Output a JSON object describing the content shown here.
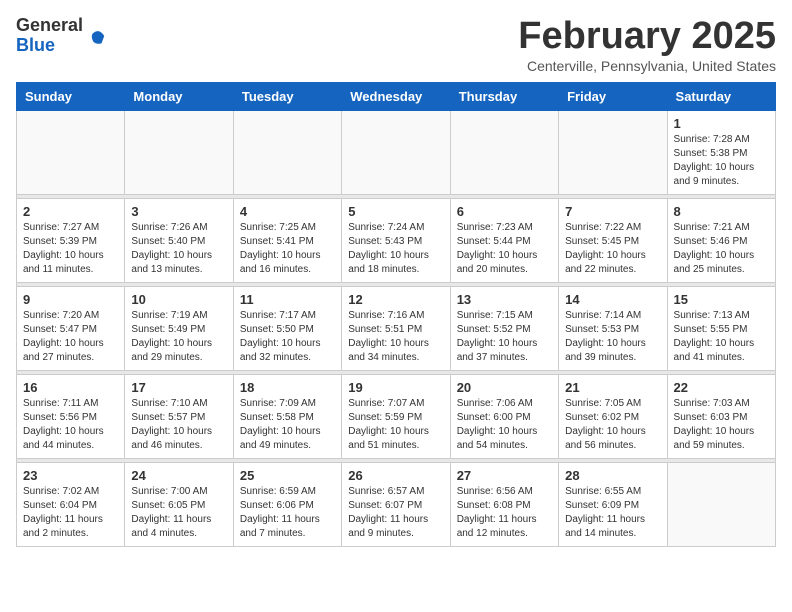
{
  "header": {
    "logo_general": "General",
    "logo_blue": "Blue",
    "month_title": "February 2025",
    "subtitle": "Centerville, Pennsylvania, United States"
  },
  "weekdays": [
    "Sunday",
    "Monday",
    "Tuesday",
    "Wednesday",
    "Thursday",
    "Friday",
    "Saturday"
  ],
  "weeks": [
    [
      {
        "day": "",
        "info": ""
      },
      {
        "day": "",
        "info": ""
      },
      {
        "day": "",
        "info": ""
      },
      {
        "day": "",
        "info": ""
      },
      {
        "day": "",
        "info": ""
      },
      {
        "day": "",
        "info": ""
      },
      {
        "day": "1",
        "info": "Sunrise: 7:28 AM\nSunset: 5:38 PM\nDaylight: 10 hours\nand 9 minutes."
      }
    ],
    [
      {
        "day": "2",
        "info": "Sunrise: 7:27 AM\nSunset: 5:39 PM\nDaylight: 10 hours\nand 11 minutes."
      },
      {
        "day": "3",
        "info": "Sunrise: 7:26 AM\nSunset: 5:40 PM\nDaylight: 10 hours\nand 13 minutes."
      },
      {
        "day": "4",
        "info": "Sunrise: 7:25 AM\nSunset: 5:41 PM\nDaylight: 10 hours\nand 16 minutes."
      },
      {
        "day": "5",
        "info": "Sunrise: 7:24 AM\nSunset: 5:43 PM\nDaylight: 10 hours\nand 18 minutes."
      },
      {
        "day": "6",
        "info": "Sunrise: 7:23 AM\nSunset: 5:44 PM\nDaylight: 10 hours\nand 20 minutes."
      },
      {
        "day": "7",
        "info": "Sunrise: 7:22 AM\nSunset: 5:45 PM\nDaylight: 10 hours\nand 22 minutes."
      },
      {
        "day": "8",
        "info": "Sunrise: 7:21 AM\nSunset: 5:46 PM\nDaylight: 10 hours\nand 25 minutes."
      }
    ],
    [
      {
        "day": "9",
        "info": "Sunrise: 7:20 AM\nSunset: 5:47 PM\nDaylight: 10 hours\nand 27 minutes."
      },
      {
        "day": "10",
        "info": "Sunrise: 7:19 AM\nSunset: 5:49 PM\nDaylight: 10 hours\nand 29 minutes."
      },
      {
        "day": "11",
        "info": "Sunrise: 7:17 AM\nSunset: 5:50 PM\nDaylight: 10 hours\nand 32 minutes."
      },
      {
        "day": "12",
        "info": "Sunrise: 7:16 AM\nSunset: 5:51 PM\nDaylight: 10 hours\nand 34 minutes."
      },
      {
        "day": "13",
        "info": "Sunrise: 7:15 AM\nSunset: 5:52 PM\nDaylight: 10 hours\nand 37 minutes."
      },
      {
        "day": "14",
        "info": "Sunrise: 7:14 AM\nSunset: 5:53 PM\nDaylight: 10 hours\nand 39 minutes."
      },
      {
        "day": "15",
        "info": "Sunrise: 7:13 AM\nSunset: 5:55 PM\nDaylight: 10 hours\nand 41 minutes."
      }
    ],
    [
      {
        "day": "16",
        "info": "Sunrise: 7:11 AM\nSunset: 5:56 PM\nDaylight: 10 hours\nand 44 minutes."
      },
      {
        "day": "17",
        "info": "Sunrise: 7:10 AM\nSunset: 5:57 PM\nDaylight: 10 hours\nand 46 minutes."
      },
      {
        "day": "18",
        "info": "Sunrise: 7:09 AM\nSunset: 5:58 PM\nDaylight: 10 hours\nand 49 minutes."
      },
      {
        "day": "19",
        "info": "Sunrise: 7:07 AM\nSunset: 5:59 PM\nDaylight: 10 hours\nand 51 minutes."
      },
      {
        "day": "20",
        "info": "Sunrise: 7:06 AM\nSunset: 6:00 PM\nDaylight: 10 hours\nand 54 minutes."
      },
      {
        "day": "21",
        "info": "Sunrise: 7:05 AM\nSunset: 6:02 PM\nDaylight: 10 hours\nand 56 minutes."
      },
      {
        "day": "22",
        "info": "Sunrise: 7:03 AM\nSunset: 6:03 PM\nDaylight: 10 hours\nand 59 minutes."
      }
    ],
    [
      {
        "day": "23",
        "info": "Sunrise: 7:02 AM\nSunset: 6:04 PM\nDaylight: 11 hours\nand 2 minutes."
      },
      {
        "day": "24",
        "info": "Sunrise: 7:00 AM\nSunset: 6:05 PM\nDaylight: 11 hours\nand 4 minutes."
      },
      {
        "day": "25",
        "info": "Sunrise: 6:59 AM\nSunset: 6:06 PM\nDaylight: 11 hours\nand 7 minutes."
      },
      {
        "day": "26",
        "info": "Sunrise: 6:57 AM\nSunset: 6:07 PM\nDaylight: 11 hours\nand 9 minutes."
      },
      {
        "day": "27",
        "info": "Sunrise: 6:56 AM\nSunset: 6:08 PM\nDaylight: 11 hours\nand 12 minutes."
      },
      {
        "day": "28",
        "info": "Sunrise: 6:55 AM\nSunset: 6:09 PM\nDaylight: 11 hours\nand 14 minutes."
      },
      {
        "day": "",
        "info": ""
      }
    ]
  ]
}
